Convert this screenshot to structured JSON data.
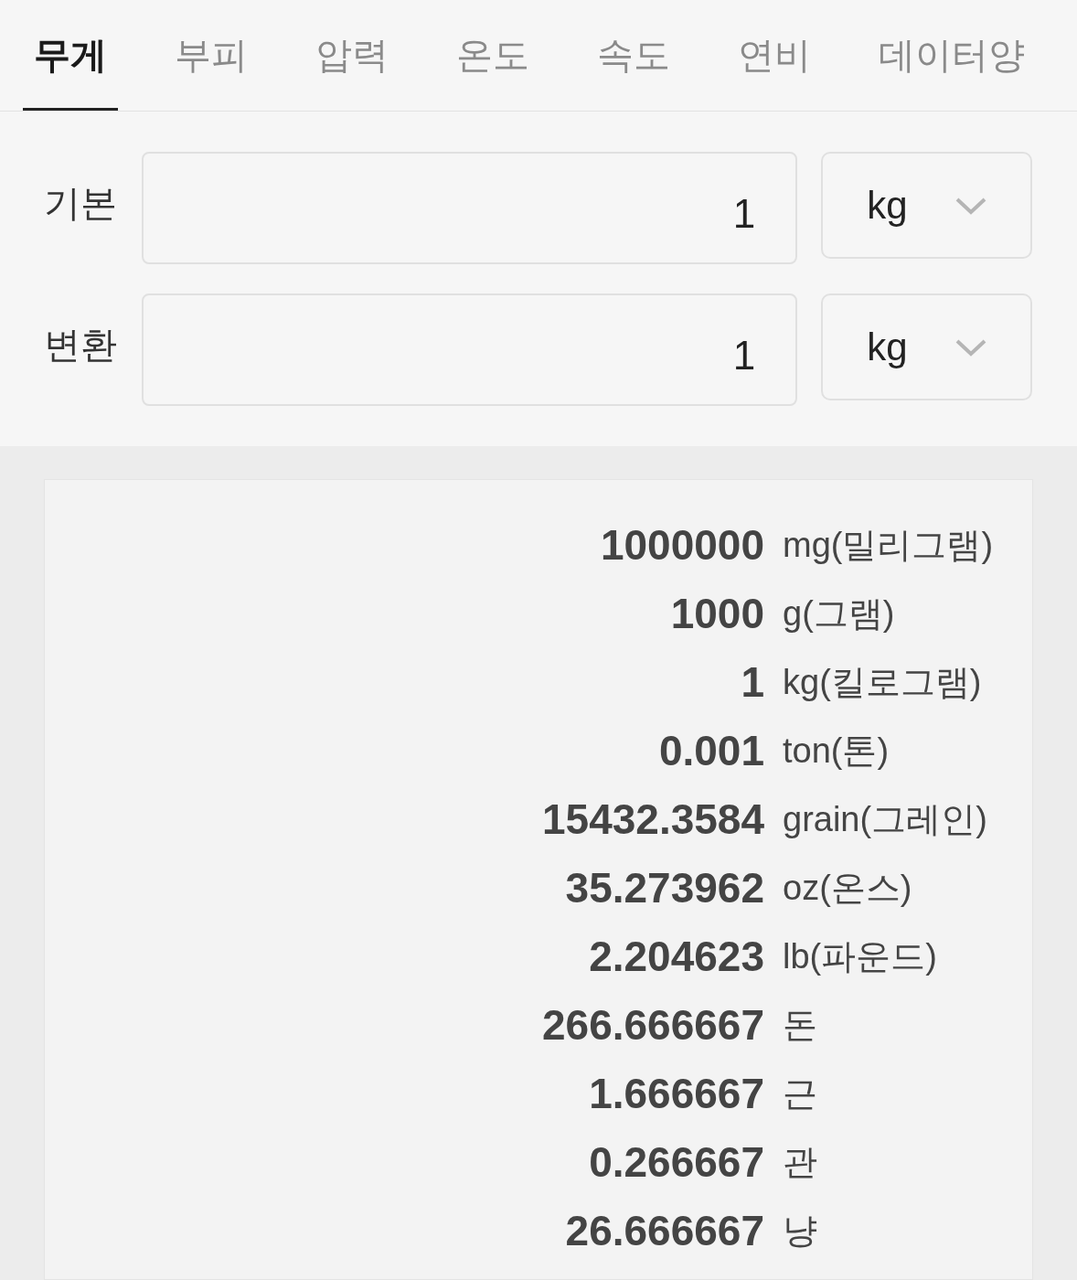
{
  "tabs": [
    {
      "label": "무게",
      "selected": true
    },
    {
      "label": "부피",
      "selected": false
    },
    {
      "label": "압력",
      "selected": false
    },
    {
      "label": "온도",
      "selected": false
    },
    {
      "label": "속도",
      "selected": false
    },
    {
      "label": "연비",
      "selected": false
    },
    {
      "label": "데이터양",
      "selected": false
    }
  ],
  "converter_rows": [
    {
      "label": "기본",
      "value": "1",
      "unit": "kg"
    },
    {
      "label": "변환",
      "value": "1",
      "unit": "kg"
    }
  ],
  "results": [
    {
      "value": "1000000",
      "unit": "mg(밀리그램)"
    },
    {
      "value": "1000",
      "unit": "g(그램)"
    },
    {
      "value": "1",
      "unit": "kg(킬로그램)"
    },
    {
      "value": "0.001",
      "unit": "ton(톤)"
    },
    {
      "value": "15432.3584",
      "unit": "grain(그레인)"
    },
    {
      "value": "35.273962",
      "unit": "oz(온스)"
    },
    {
      "value": "2.204623",
      "unit": "lb(파운드)"
    },
    {
      "value": "266.666667",
      "unit": "돈"
    },
    {
      "value": "1.666667",
      "unit": "근"
    },
    {
      "value": "0.266667",
      "unit": "관"
    },
    {
      "value": "26.666667",
      "unit": "냥"
    }
  ]
}
